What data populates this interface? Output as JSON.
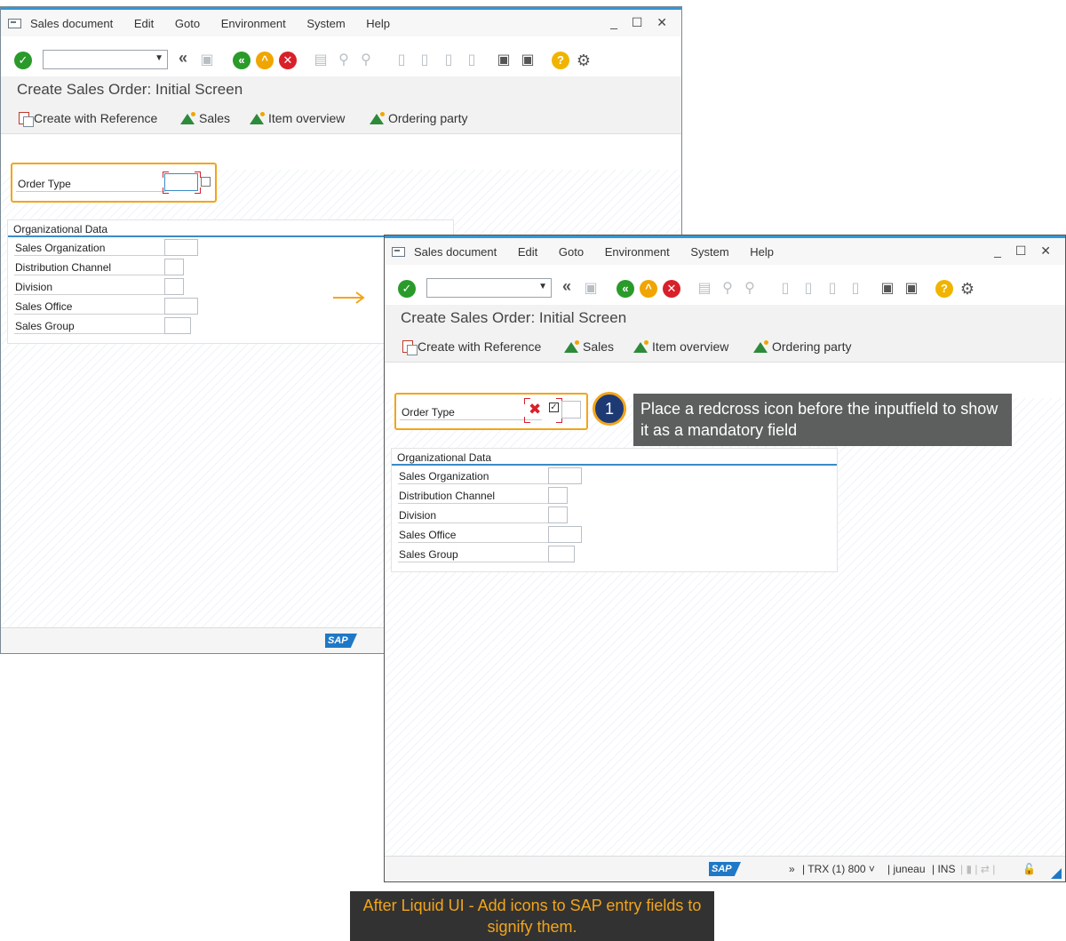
{
  "menu": {
    "items": [
      "Sales document",
      "Edit",
      "Goto",
      "Environment",
      "System",
      "Help"
    ],
    "window_controls": "_ ☐ ✕"
  },
  "screen": {
    "title": "Create Sales Order: Initial Screen"
  },
  "app_toolbar": {
    "create_with_reference": "Create with Reference",
    "sales": "Sales",
    "item_overview": "Item overview",
    "ordering_party": "Ordering party"
  },
  "form": {
    "order_type_label": "Order Type",
    "org_data_title": "Organizational Data",
    "fields": [
      "Sales Organization",
      "Distribution Channel",
      "Division",
      "Sales Office",
      "Sales Group"
    ]
  },
  "status": {
    "expand": "»",
    "system": "TRX (1) 800",
    "user": "juneau",
    "mode": "INS"
  },
  "callout": {
    "number": "1",
    "text": "Place a redcross icon before the inputfield to show it as a mandatory field"
  },
  "caption": {
    "text": "After Liquid UI - Add icons to SAP entry fields to signify them."
  },
  "icons": {
    "toolbar": [
      "enter-check-icon",
      "back-icon",
      "save-icon",
      "back-green-icon",
      "exit-yellow-icon",
      "cancel-red-icon",
      "print-icon",
      "find-icon",
      "find-next-icon",
      "first-page-icon",
      "prev-page-icon",
      "next-page-icon",
      "last-page-icon",
      "new-session-icon",
      "shortcut-icon",
      "help-icon",
      "settings-icon"
    ],
    "accent": "#f2a51a",
    "brand": "#3397d7"
  }
}
